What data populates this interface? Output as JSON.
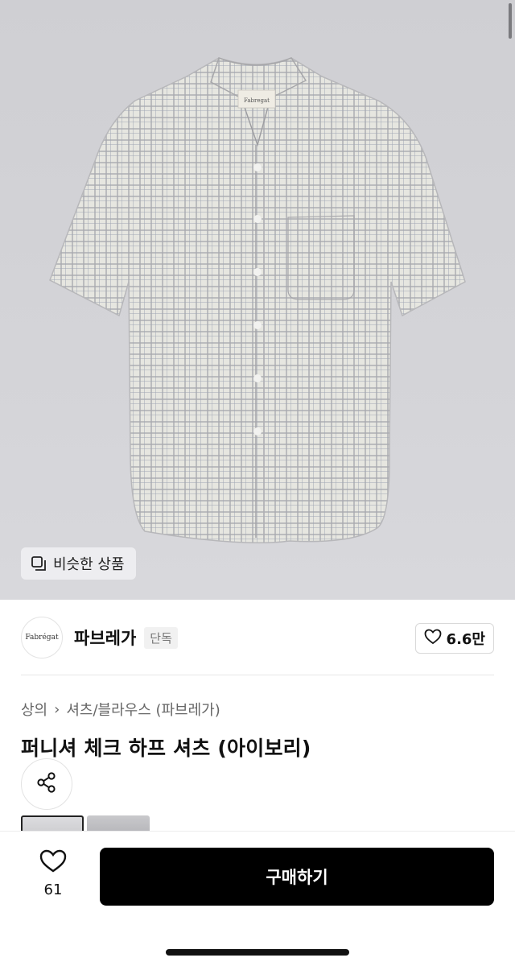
{
  "hero": {
    "image_alt": "check half shirt product photo",
    "shirt_tag_text": "Fabregat",
    "similar_button_label": "비슷한 상품",
    "similar_icon": "copy-icon"
  },
  "brand": {
    "logo_text": "Fabrégat",
    "name": "파브레가",
    "tag": "단독",
    "likes": "6.6만",
    "like_icon": "heart-icon"
  },
  "breadcrumb": {
    "category": "상의",
    "separator": "›",
    "subcategory": "셔츠/블라우스 (파브레가)"
  },
  "product": {
    "title": "퍼니셔 체크 하프 셔츠 (아이보리)"
  },
  "actions": {
    "share_icon": "share-icon"
  },
  "bottom_bar": {
    "wish_count": "61",
    "buy_label": "구매하기"
  },
  "colors": {
    "buy_button_bg": "#000000",
    "hero_bg": "#d2d2d6"
  }
}
